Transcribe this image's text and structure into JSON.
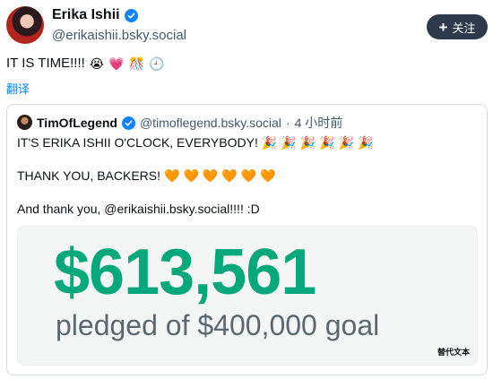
{
  "post": {
    "author_name": "Erika Ishii",
    "handle": "@erikaishii.bsky.social",
    "follow_label": "关注",
    "text": "IT IS TIME!!!!",
    "text_emojis": [
      "😭",
      "💗",
      "🎊",
      "🕘"
    ],
    "translate_label": "翻译"
  },
  "quote": {
    "author_name": "TimOfLegend",
    "handle": "@timoflegend.bsky.social",
    "separator": "·",
    "time": "4 小时前",
    "line1": "IT'S ERIKA ISHII O'CLOCK, EVERYBODY!",
    "line1_emojis": [
      "🎉",
      "🎉",
      "🎉",
      "🎉",
      "🎉",
      "🎉"
    ],
    "line2": "THANK YOU, BACKERS!",
    "line2_emojis": [
      "🧡",
      "🧡",
      "🧡",
      "🧡",
      "🧡",
      "🧡"
    ],
    "line3": "And thank you, @erikaishii.bsky.social!!!! :D"
  },
  "image": {
    "amount": "$613,561",
    "goal_text": "pledged of $400,000 goal",
    "alt_label": "替代文本"
  },
  "colors": {
    "accent": "#1083fe",
    "amount_green": "#05a87a",
    "follow_bg": "#2c3a4b"
  }
}
